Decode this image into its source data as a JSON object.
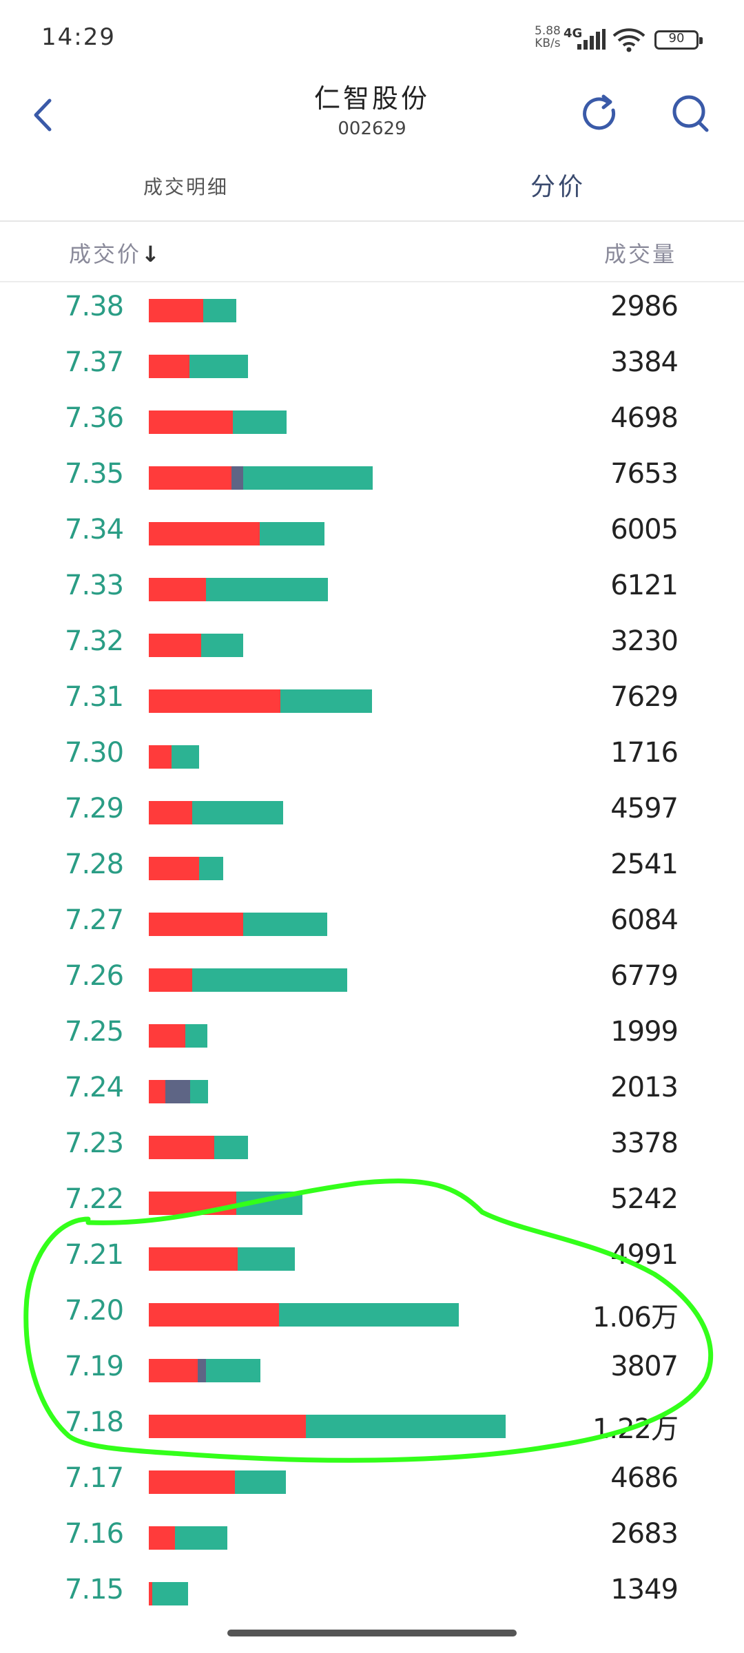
{
  "status_bar": {
    "time": "14:29",
    "net_speed_value": "5.88",
    "net_speed_unit": "KB/s",
    "net_type": "4G",
    "battery": "90"
  },
  "header": {
    "title": "仁智股份",
    "code": "002629"
  },
  "tabs": [
    {
      "label": "成交明细",
      "active": false
    },
    {
      "label": "分价",
      "active": true
    }
  ],
  "table": {
    "col_price": "成交价",
    "sort_arrow": "↓",
    "col_volume": "成交量",
    "rows": [
      {
        "price": "7.38",
        "volume": "2986",
        "red": 0.62,
        "gray": 0.0,
        "green": 0.38
      },
      {
        "price": "7.37",
        "volume": "3384",
        "red": 0.41,
        "gray": 0.0,
        "green": 0.59
      },
      {
        "price": "7.36",
        "volume": "4698",
        "red": 0.61,
        "gray": 0.0,
        "green": 0.39
      },
      {
        "price": "7.35",
        "volume": "7653",
        "red": 0.37,
        "gray": 0.05,
        "green": 0.58
      },
      {
        "price": "7.34",
        "volume": "6005",
        "red": 0.63,
        "gray": 0.0,
        "green": 0.37
      },
      {
        "price": "7.33",
        "volume": "6121",
        "red": 0.32,
        "gray": 0.0,
        "green": 0.68
      },
      {
        "price": "7.32",
        "volume": "3230",
        "red": 0.55,
        "gray": 0.0,
        "green": 0.45
      },
      {
        "price": "7.31",
        "volume": "7629",
        "red": 0.59,
        "gray": 0.0,
        "green": 0.41
      },
      {
        "price": "7.30",
        "volume": "1716",
        "red": 0.45,
        "gray": 0.0,
        "green": 0.55
      },
      {
        "price": "7.29",
        "volume": "4597",
        "red": 0.32,
        "gray": 0.0,
        "green": 0.68
      },
      {
        "price": "7.28",
        "volume": "2541",
        "red": 0.68,
        "gray": 0.0,
        "green": 0.32
      },
      {
        "price": "7.27",
        "volume": "6084",
        "red": 0.53,
        "gray": 0.0,
        "green": 0.47
      },
      {
        "price": "7.26",
        "volume": "6779",
        "red": 0.22,
        "gray": 0.0,
        "green": 0.78
      },
      {
        "price": "7.25",
        "volume": "1999",
        "red": 0.62,
        "gray": 0.0,
        "green": 0.38
      },
      {
        "price": "7.24",
        "volume": "2013",
        "red": 0.28,
        "gray": 0.42,
        "green": 0.3
      },
      {
        "price": "7.23",
        "volume": "3378",
        "red": 0.66,
        "gray": 0.0,
        "green": 0.34
      },
      {
        "price": "7.22",
        "volume": "5242",
        "red": 0.57,
        "gray": 0.0,
        "green": 0.43
      },
      {
        "price": "7.21",
        "volume": "4991",
        "red": 0.61,
        "gray": 0.0,
        "green": 0.39
      },
      {
        "price": "7.20",
        "volume": "1.06万",
        "red": 0.42,
        "gray": 0.0,
        "green": 0.58
      },
      {
        "price": "7.19",
        "volume": "3807",
        "red": 0.44,
        "gray": 0.07,
        "green": 0.49
      },
      {
        "price": "7.18",
        "volume": "1.22万",
        "red": 0.44,
        "gray": 0.0,
        "green": 0.56
      },
      {
        "price": "7.17",
        "volume": "4686",
        "red": 0.63,
        "gray": 0.0,
        "green": 0.37
      },
      {
        "price": "7.16",
        "volume": "2683",
        "red": 0.33,
        "gray": 0.0,
        "green": 0.67
      },
      {
        "price": "7.15",
        "volume": "1349",
        "red": 0.08,
        "gray": 0.0,
        "green": 0.92
      }
    ]
  },
  "colors": {
    "buy": "#ff3b3b",
    "neutral": "#5e6585",
    "sell": "#2cb393",
    "price_text": "#2a9d85",
    "annotation": "#33ff1a"
  },
  "icons": {
    "back": "chevron-left-icon",
    "refresh": "refresh-icon",
    "search": "search-icon"
  }
}
